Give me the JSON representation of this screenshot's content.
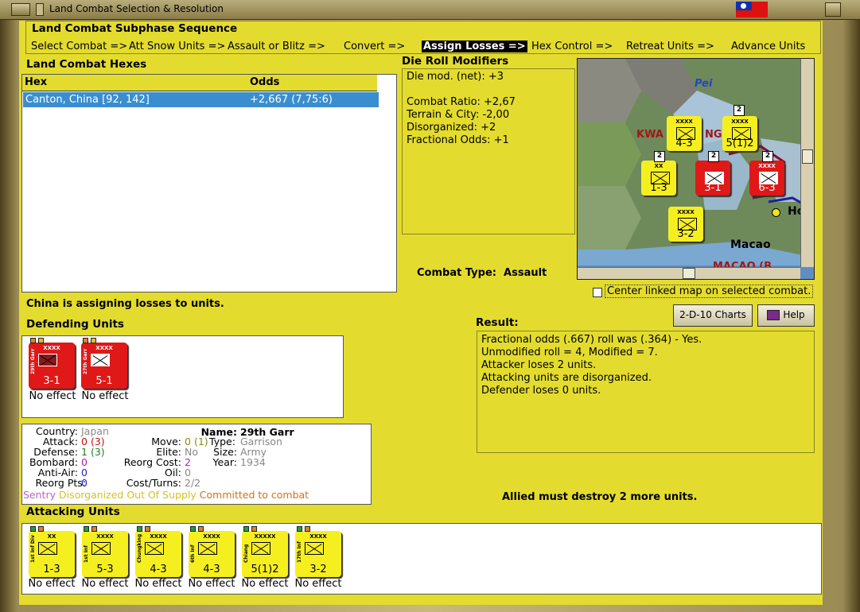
{
  "window": {
    "title": "Land Combat Selection & Resolution"
  },
  "subphase": {
    "title": "Land Combat Subphase Sequence",
    "steps": [
      "Select Combat =>",
      "Att Snow Units =>",
      "Assault or Blitz =>",
      "Convert =>",
      "Assign Losses =>",
      "Hex Control =>",
      "Retreat Units =>",
      "Advance Units"
    ],
    "active_index": 4
  },
  "hexes": {
    "title": "Land Combat Hexes",
    "col_hex": "Hex",
    "col_odds": "Odds",
    "rows": [
      {
        "hex": "Canton, China [92, 142]",
        "odds": "+2,667 (7,75:6)"
      }
    ]
  },
  "die_mods": {
    "title": "Die Roll Modifiers",
    "lines": [
      "Die mod. (net): +3",
      "",
      "Combat Ratio: +2,67",
      "Terrain & City: -2,00",
      "Disorganized: +2",
      "Fractional Odds: +1"
    ]
  },
  "combat_type": {
    "label": "Combat Type:",
    "value": "Assault"
  },
  "center_map": {
    "label": "Center linked map on selected combat.",
    "checked": false
  },
  "buttons": {
    "charts": "2-D-10 Charts",
    "help": "Help"
  },
  "status": "China is assigning losses to units.",
  "defending": {
    "title": "Defending Units",
    "units": [
      {
        "name": "29th Garr",
        "size": "XXXX",
        "strength": "3-1",
        "effect": "No effect"
      },
      {
        "name": "27th Garr",
        "size": "XXXX",
        "strength": "5-1",
        "effect": "No effect"
      }
    ]
  },
  "unit_info": {
    "country_label": "Country:",
    "country": "Japan",
    "name_label": "Name:",
    "name": "29th Garr",
    "attack_label": "Attack:",
    "attack": "0",
    "attack_mod": "(3)",
    "move_label": "Move:",
    "move": "0",
    "move_mod": "(1)",
    "type_label": "Type:",
    "type": "Garrison",
    "defense_label": "Defense:",
    "defense": "1",
    "defense_mod": "(3)",
    "elite_label": "Elite:",
    "elite": "No",
    "size_label": "Size:",
    "size": "Army",
    "bombard_label": "Bombard:",
    "bombard": "0",
    "reorg_cost_label": "Reorg Cost:",
    "reorg_cost": "2",
    "year_label": "Year:",
    "year": "1934",
    "aa_label": "Anti-Air:",
    "aa": "0",
    "oil_label": "Oil:",
    "oil": "0",
    "reorg_pts_label": "Reorg Pts:",
    "reorg_pts": "0",
    "cost_label": "Cost/Turns:",
    "cost": "2/2",
    "flag_sentry": "Sentry",
    "flag_disorg": "Disorganized",
    "flag_supply": "Out Of Supply",
    "flag_committed": "Committed to combat"
  },
  "result": {
    "title": "Result:",
    "lines": [
      "Fractional odds (.667) roll was (.364)  - Yes.",
      "Unmodified roll = 4, Modified = 7.",
      "Attacker loses 2 units.",
      "Attacking units are disorganized.",
      "Defender loses 0 units."
    ]
  },
  "allied_msg": "Allied must destroy 2 more units.",
  "attacking": {
    "title": "Attacking Units",
    "units": [
      {
        "name": "1st Inf Div",
        "size": "XX",
        "strength": "1-3",
        "effect": "No effect"
      },
      {
        "name": "1st Inf",
        "size": "XXXX",
        "strength": "5-3",
        "effect": "No effect"
      },
      {
        "name": "Chungking",
        "size": "XXXX",
        "strength": "4-3",
        "effect": "No effect"
      },
      {
        "name": "6th Inf",
        "size": "XXXX",
        "strength": "4-3",
        "effect": "No effect"
      },
      {
        "name": "Chiang",
        "size": "XXXXX",
        "strength": "5(1)2",
        "effect": "No effect"
      },
      {
        "name": "17th Inf",
        "size": "XXXX",
        "strength": "3-2",
        "effect": "No effect"
      }
    ]
  },
  "map": {
    "labels": [
      "Pei",
      "KWA",
      "NG",
      "Macao",
      "MACAO (B",
      "Ho"
    ],
    "counters": [
      {
        "name": "Chungking",
        "size": "XXXX",
        "strength": "4-3"
      },
      {
        "name": "Chiang",
        "size": "XXXX",
        "strength": "5(1)2"
      },
      {
        "name": "1st Inf Div",
        "size": "XX",
        "strength": "1-3"
      },
      {
        "name": "29th Garr",
        "size": "",
        "strength": "3-1"
      },
      {
        "name": "Garr",
        "size": "XXXX",
        "strength": "6-3"
      },
      {
        "name": "17th Inf",
        "size": "XXXX",
        "strength": "3-2"
      }
    ],
    "stack_badges": [
      "2",
      "2",
      "2",
      "2"
    ]
  },
  "colors": {
    "panel": "#e3dc2e",
    "counter_yellow": "#f6ef20",
    "counter_red": "#e01818",
    "selection": "#3a8ed0"
  }
}
